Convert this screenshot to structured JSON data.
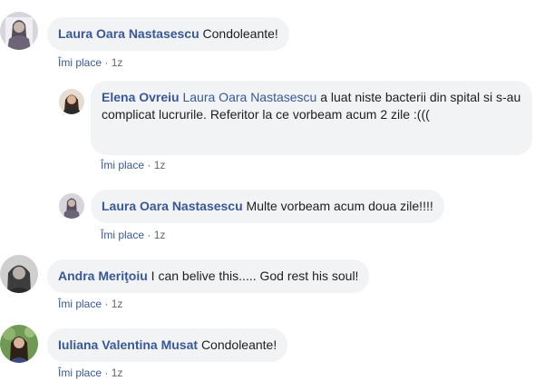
{
  "comments": [
    {
      "author": "Laura Oara Nastasescu",
      "text": "Condoleante!",
      "like_label": "Îmi place",
      "separator": " · ",
      "time": "1z"
    },
    {
      "author": "Elena Ovreiu",
      "mention": "Laura Oara Nastasescu",
      "text": " a luat niste bacterii din spital si s-au complicat lucrurile. Referitor la ce vorbeam acum 2 zile :(((",
      "like_label": "Îmi place",
      "separator": " · ",
      "time": "1z"
    },
    {
      "author": "Laura Oara Nastasescu",
      "text": "Multe vorbeam acum doua zile!!!!",
      "like_label": "Îmi place",
      "separator": " · ",
      "time": "1z"
    },
    {
      "author": "Andra Meriţoiu",
      "text": "I can belive this..... God rest his soul!",
      "like_label": "Îmi place",
      "separator": " · ",
      "time": "1z"
    },
    {
      "author": "Iuliana Valentina Musat",
      "text": "Condoleante!",
      "like_label": "Îmi place",
      "separator": " · ",
      "time": "1z"
    }
  ],
  "colors": {
    "link": "#385898",
    "bubble": "#f2f3f5",
    "meta": "#606770"
  }
}
